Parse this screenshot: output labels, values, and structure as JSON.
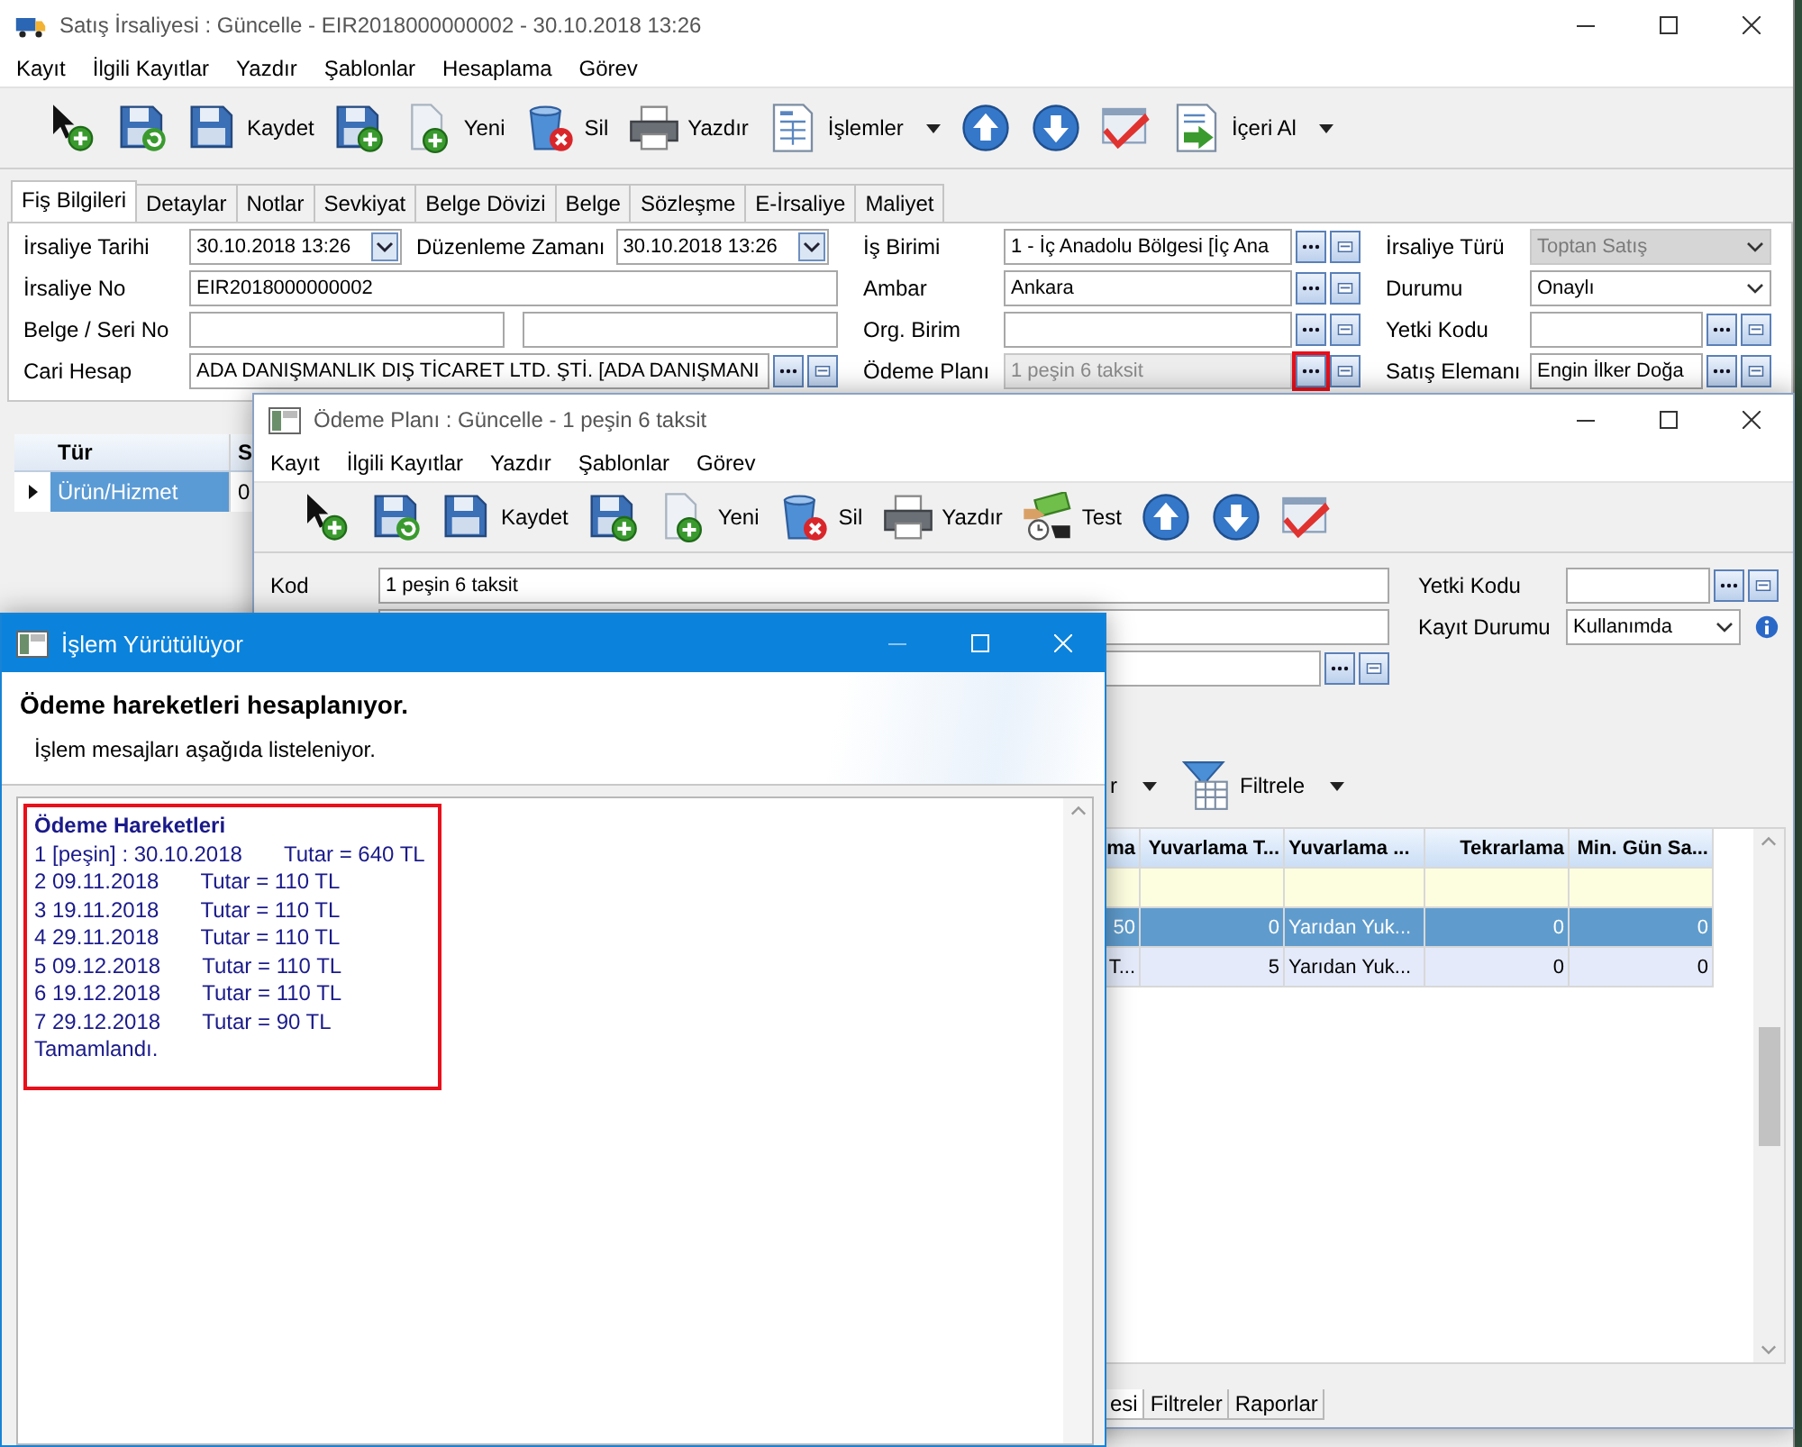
{
  "main_window": {
    "title": "Satış İrsaliyesi : Güncelle - EIR2018000000002 - 30.10.2018 13:26",
    "menu": [
      "Kayıt",
      "İlgili Kayıtlar",
      "Yazdır",
      "Şablonlar",
      "Hesaplama",
      "Görev"
    ],
    "toolbar": [
      {
        "label": "Kaydet",
        "dropdown": false
      },
      {
        "label": "Yeni",
        "dropdown": false
      },
      {
        "label": "Sil",
        "dropdown": false
      },
      {
        "label": "Yazdır",
        "dropdown": false
      },
      {
        "label": "İşlemler",
        "dropdown": true
      },
      {
        "label": "İçeri Al",
        "dropdown": true
      }
    ],
    "tabs": [
      {
        "label": "Fiş Bilgileri",
        "selected": true
      },
      {
        "label": "Detaylar",
        "selected": false
      },
      {
        "label": "Notlar",
        "selected": false
      },
      {
        "label": "Sevkiyat",
        "selected": false
      },
      {
        "label": "Belge Dövizi",
        "selected": false
      },
      {
        "label": "Belge",
        "selected": false
      },
      {
        "label": "Sözleşme",
        "selected": false
      },
      {
        "label": "E-İrsaliye",
        "selected": false
      },
      {
        "label": "Maliyet",
        "selected": false
      }
    ],
    "form": {
      "columns": [
        {
          "rows": [
            {
              "fields": [
                {
                  "label": "İrsaliye Tarihi",
                  "value": "30.10.2018 13:26",
                  "kind": "date",
                  "disabled": false
                },
                {
                  "label": "Düzenleme Zamanı",
                  "value": "30.10.2018 13:26",
                  "kind": "date",
                  "disabled": false
                }
              ]
            },
            {
              "fields": [
                {
                  "label": "İrsaliye No",
                  "value": "EIR2018000000002",
                  "kind": "text",
                  "disabled": false
                }
              ]
            },
            {
              "fields": [
                {
                  "label": "Belge / Seri No",
                  "kind": "pair",
                  "disabled": false
                }
              ]
            },
            {
              "fields": [
                {
                  "label": "Cari Hesap",
                  "value": "ADA DANIŞMANLIK DIŞ TİCARET LTD. ŞTİ. [ADA DANIŞMANI",
                  "kind": "lookup",
                  "disabled": false,
                  "highlighted": false
                }
              ]
            }
          ]
        },
        {
          "rows": [
            {
              "fields": [
                {
                  "label": "İş Birimi",
                  "value": "1 - İç Anadolu Bölgesi [İç Ana",
                  "kind": "lookup",
                  "disabled": false,
                  "highlighted": false
                }
              ]
            },
            {
              "fields": [
                {
                  "label": "Ambar",
                  "value": "Ankara",
                  "kind": "lookup",
                  "disabled": false,
                  "highlighted": false
                }
              ]
            },
            {
              "fields": [
                {
                  "label": "Org. Birim",
                  "kind": "lookup",
                  "disabled": false,
                  "highlighted": false
                }
              ]
            },
            {
              "fields": [
                {
                  "label": "Ödeme Planı",
                  "value": "1 peşin 6 taksit",
                  "kind": "lookup",
                  "disabled": true,
                  "highlighted": true
                }
              ]
            }
          ]
        },
        {
          "rows": [
            {
              "fields": [
                {
                  "label": "İrsaliye Türü",
                  "value": "Toptan Satış",
                  "kind": "combo",
                  "disabled": true
                }
              ]
            },
            {
              "fields": [
                {
                  "label": "Durumu",
                  "value": "Onaylı",
                  "kind": "combo",
                  "disabled": false
                }
              ]
            },
            {
              "fields": [
                {
                  "label": "Yetki Kodu",
                  "kind": "lookup",
                  "disabled": false,
                  "highlighted": false
                }
              ]
            },
            {
              "fields": [
                {
                  "label": "Satış Elemanı",
                  "value": "Engin İlker Doğa",
                  "kind": "lookup",
                  "disabled": false,
                  "highlighted": false
                }
              ]
            }
          ]
        }
      ]
    },
    "grid": {
      "columns": [
        "Tür",
        "S"
      ],
      "rows": [
        {
          "cells": [
            "Ürün/Hizmet",
            "0"
          ],
          "selected": true
        }
      ]
    }
  },
  "payment_plan_window": {
    "title": "Ödeme Planı : Güncelle - 1 peşin 6 taksit",
    "menu": [
      "Kayıt",
      "İlgili Kayıtlar",
      "Yazdır",
      "Şablonlar",
      "Görev"
    ],
    "toolbar": [
      {
        "label": "Kaydet",
        "dropdown": false
      },
      {
        "label": "Yeni",
        "dropdown": false
      },
      {
        "label": "Sil",
        "dropdown": false
      },
      {
        "label": "Yazdır",
        "dropdown": false
      },
      {
        "label": "Test",
        "dropdown": false
      }
    ],
    "form": {
      "columns": [
        {
          "rows": [
            {
              "fields": [
                {
                  "label": "Kod",
                  "value": "1 peşin 6 taksit",
                  "kind": "text",
                  "disabled": false
                }
              ]
            },
            {
              "fields": [
                {
                  "kind": "text",
                  "disabled": false
                }
              ]
            },
            {
              "fields": [
                {
                  "kind": "lookup",
                  "disabled": false,
                  "highlighted": false
                }
              ]
            }
          ]
        },
        {
          "rows": [
            {
              "fields": [
                {
                  "label": "Yetki Kodu",
                  "kind": "lookup",
                  "disabled": false,
                  "highlighted": false
                }
              ]
            },
            {
              "fields": [
                {
                  "label": "Kayıt Durumu",
                  "value": "Kullanımda",
                  "kind": "infocombo",
                  "disabled": false
                }
              ]
            }
          ]
        }
      ]
    },
    "grid_toolbar": [
      {
        "label": "r",
        "kind": "plain",
        "dropdown": true
      },
      {
        "label": "Filtrele",
        "kind": "filter",
        "dropdown": true
      }
    ],
    "grid": {
      "columns": [
        "ma",
        "Yuvarlama T...",
        "Yuvarlama ...",
        "Tekrarlama",
        "Min. Gün Sa..."
      ],
      "filter_row": true,
      "rows": [
        {
          "cells": [
            "50",
            "0",
            "Yarıdan Yuk...",
            "0",
            "0"
          ],
          "selected": true
        },
        {
          "cells": [
            "T...",
            "5",
            "Yarıdan Yuk...",
            "0",
            "0"
          ],
          "selected": false
        }
      ]
    },
    "bottom_tabs": [
      {
        "label": "esi",
        "selected": true
      },
      {
        "label": "Filtreler",
        "selected": false
      },
      {
        "label": "Raporlar",
        "selected": false
      }
    ]
  },
  "progress_dialog": {
    "title": "İşlem Yürütülüyor",
    "heading": "Ödeme hareketleri hesaplanıyor.",
    "subheading": "İşlem mesajları aşağıda listeleniyor.",
    "log": {
      "highlighted": true,
      "title": "Ödeme Hareketleri",
      "entries": [
        {
          "label": "1 [peşin] : 30.10.2018",
          "amount": "Tutar = 640 TL"
        },
        {
          "label": "2 09.11.2018",
          "amount": "Tutar = 110 TL"
        },
        {
          "label": "3 19.11.2018",
          "amount": "Tutar = 110 TL"
        },
        {
          "label": "4 29.11.2018",
          "amount": "Tutar = 110 TL"
        },
        {
          "label": "5 09.12.2018",
          "amount": "Tutar = 110 TL"
        },
        {
          "label": "6 19.12.2018",
          "amount": "Tutar = 110 TL"
        },
        {
          "label": "7 29.12.2018",
          "amount": "Tutar = 90 TL"
        }
      ],
      "footer": "Tamamlandı."
    }
  }
}
